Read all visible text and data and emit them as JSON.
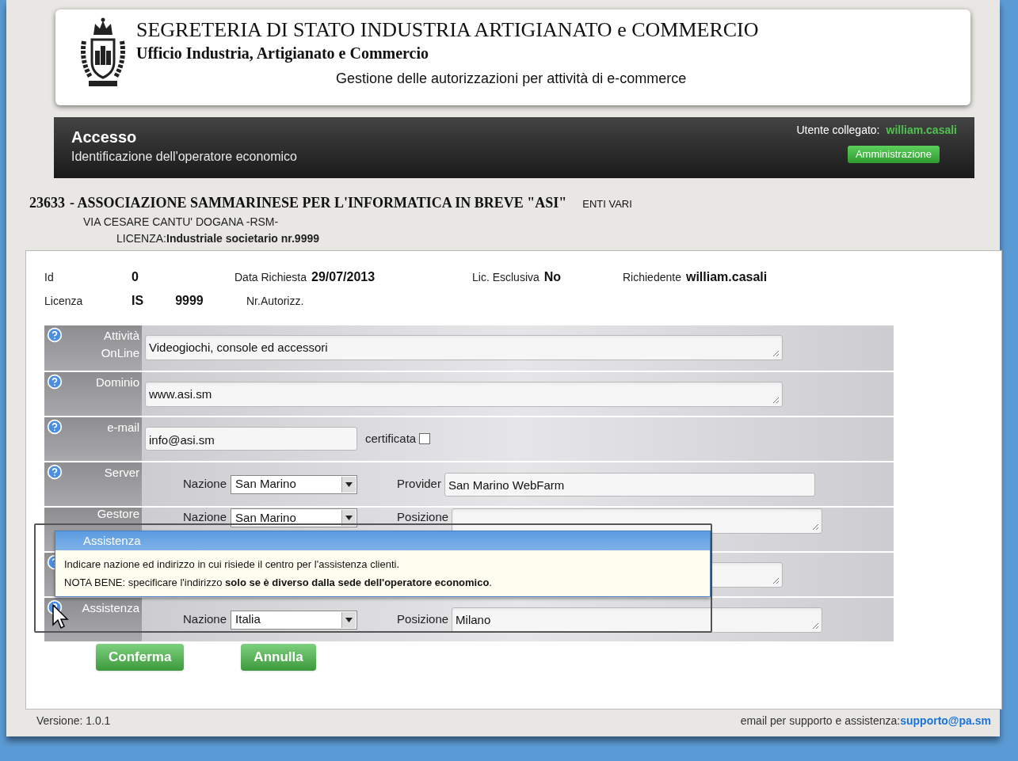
{
  "header": {
    "title": "SEGRETERIA DI STATO INDUSTRIA ARTIGIANATO e COMMERCIO",
    "subtitle": "Ufficio Industria, Artigianato e Commercio",
    "tagline": "Gestione delle autorizzazioni per attività di e-commerce"
  },
  "nav_bar": {
    "title": "Accesso",
    "subtitle": "Identificazione dell'operatore economico",
    "user_label": "Utente collegato:",
    "user": "william.casali",
    "admin_button": "Amministrazione"
  },
  "operator": {
    "code": "23633",
    "name": "- ASSOCIAZIONE SAMMARINESE PER L'INFORMATICA IN BREVE \"ASI\"",
    "category": "ENTI VARI",
    "address": "VIA CESARE CANTU' DOGANA -RSM-",
    "license": "LICENZA:**Industriale societario nr.9999**"
  },
  "info": [
    [
      {
        "label": "Id",
        "values": [
          "0"
        ]
      },
      {
        "label": "Data Richiesta",
        "values": [
          "29/07/2013"
        ]
      },
      {
        "label": "Lic. Esclusiva",
        "values": [
          "No"
        ]
      },
      {
        "label": "Richiedente",
        "values": [
          "william.casali"
        ]
      }
    ],
    [
      {
        "label": "Licenza",
        "values": [
          "IS",
          "9999"
        ]
      },
      {
        "label": "Nr.Autorizz."
      }
    ]
  ],
  "rows": [
    {
      "kind": "textarea",
      "label": "Attività OnLine",
      "value": "Videogiochi, console ed accessori"
    },
    {
      "kind": "textarea",
      "label": "Dominio",
      "value": "www.asi.sm"
    },
    {
      "kind": "check",
      "label": "e-mail",
      "value": "info@asi.sm",
      "check_label": "certificata",
      "checked": false
    },
    {
      "kind": "location",
      "label": "Server",
      "country_label": "Nazione",
      "country": "San Marino",
      "place_label": "Provider",
      "place": "San Marino WebFarm",
      "resizable": false
    },
    {
      "kind": "location",
      "label": "Gestore",
      "country_label": "Nazione",
      "country": "San Marino",
      "place_label": "Posizione",
      "resizable": true
    },
    {
      "kind": "textarea"
    },
    {
      "kind": "location",
      "label": "Assistenza",
      "country_label": "Nazione",
      "country": "Italia",
      "place_label": "Posizione",
      "place": "Milano",
      "resizable": true
    }
  ],
  "tooltip": {
    "title": "Assistenza",
    "lines": [
      "Indicare nazione ed indirizzo in cui risiede il centro per l'assistenza clienti.",
      "NOTA BENE: specificare l'indirizzo **solo se è diverso dalla sede dell'operatore economico**."
    ]
  },
  "buttons": [
    "Conferma",
    "Annulla"
  ],
  "footer": {
    "version": "Versione: 1.0.1",
    "support_label": "email per supporto e assistenza:",
    "support_email": "supporto@pa.sm"
  }
}
